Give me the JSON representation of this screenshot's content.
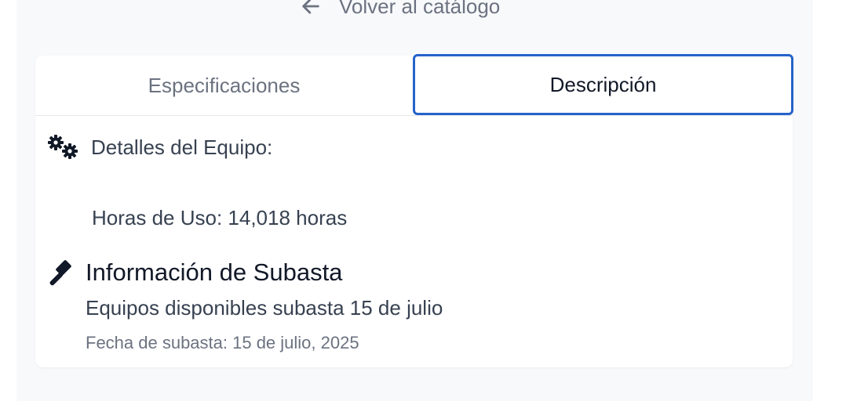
{
  "nav": {
    "back_label": "Volver al catálogo"
  },
  "tabs": [
    {
      "label": "Especificaciones",
      "active": false
    },
    {
      "label": "Descripción",
      "active": true
    }
  ],
  "details": {
    "title": "Detalles del Equipo:",
    "hours": "Horas de Uso: 14,018 horas",
    "icon": "gears-icon"
  },
  "auction": {
    "title": "Información de Subasta",
    "description": "Equipos disponibles subasta 15 de julio",
    "date": "Fecha de subasta: 15 de julio, 2025",
    "icon": "gavel-icon"
  },
  "colors": {
    "active_tab_border": "#2563c9",
    "text_primary": "#111827",
    "text_secondary": "#374151",
    "text_muted": "#6b7280",
    "page_background": "#f8f9fb"
  }
}
